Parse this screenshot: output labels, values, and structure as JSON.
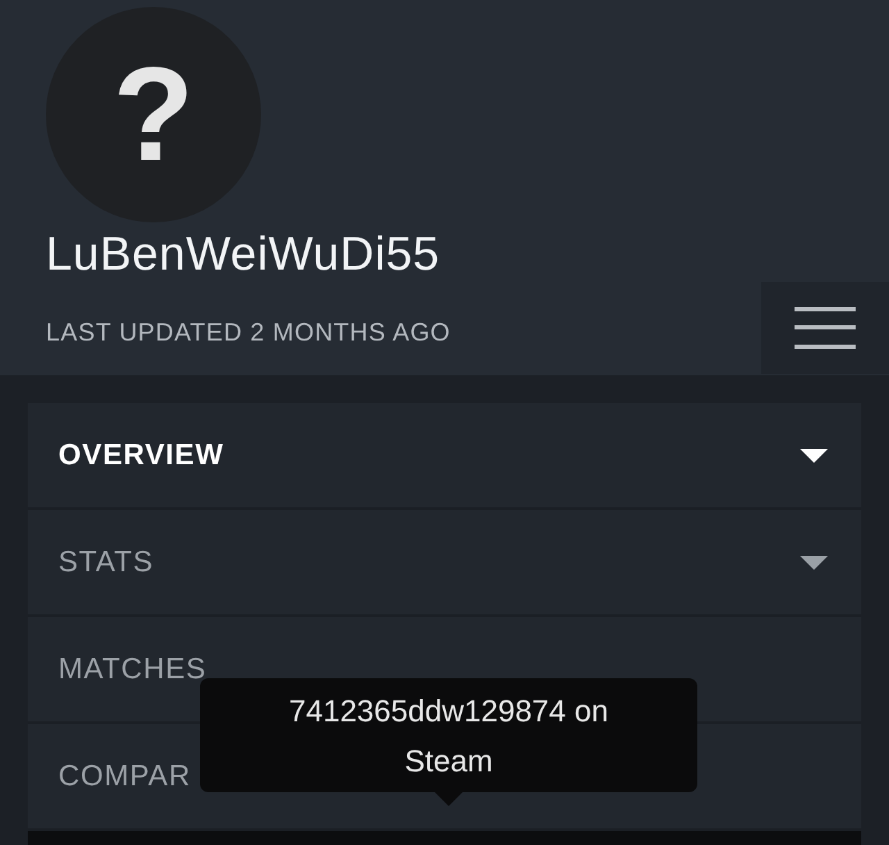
{
  "profile": {
    "avatar_glyph": "?",
    "name": "LuBenWeiWuDi55",
    "updated": "LAST UPDATED 2 MONTHS AGO"
  },
  "nav": [
    {
      "label": "OVERVIEW",
      "kind": "dropdown",
      "selected": true
    },
    {
      "label": "STATS",
      "kind": "dropdown",
      "selected": false
    },
    {
      "label": "MATCHES",
      "kind": "link",
      "selected": false
    },
    {
      "label": "COMPAR",
      "kind": "link",
      "selected": false
    }
  ],
  "tooltip": {
    "text": "7412365ddw129874 on Steam"
  }
}
